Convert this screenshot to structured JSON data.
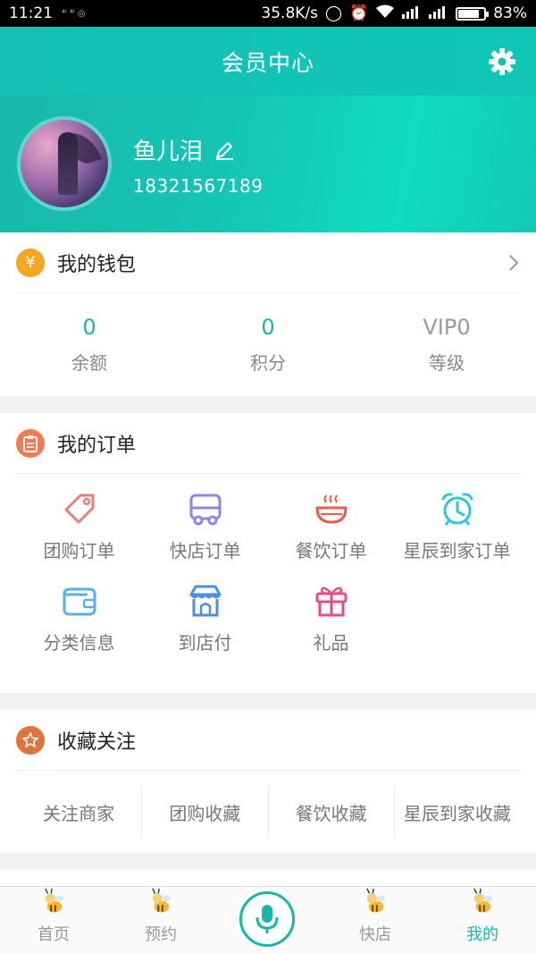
{
  "status_bar": {
    "time": "11:21",
    "speed": "35.8K/s",
    "battery": "83%",
    "battery_level": 0.83
  },
  "header": {
    "title": "会员中心"
  },
  "profile": {
    "name": "鱼儿泪",
    "phone": "18321567189"
  },
  "wallet": {
    "title": "我的钱包",
    "icon_symbol": "¥",
    "stats": [
      {
        "value": "0",
        "label": "余额"
      },
      {
        "value": "0",
        "label": "积分"
      },
      {
        "value": "VIP0",
        "label": "等级"
      }
    ]
  },
  "orders": {
    "title": "我的订单",
    "items": [
      {
        "label": "团购订单",
        "icon": "tag-icon",
        "color": "#f07b7b"
      },
      {
        "label": "快店订单",
        "icon": "truck-icon",
        "color": "#8b86e8"
      },
      {
        "label": "餐饮订单",
        "icon": "bowl-icon",
        "color": "#f05a4a"
      },
      {
        "label": "星辰到家订单",
        "icon": "alarm-clock-icon",
        "color": "#2cc7e0"
      },
      {
        "label": "分类信息",
        "icon": "wallet-icon",
        "color": "#5aaeea"
      },
      {
        "label": "到店付",
        "icon": "store-icon",
        "color": "#4d8ee0"
      },
      {
        "label": "礼品",
        "icon": "gift-icon",
        "color": "#e44c8a"
      }
    ]
  },
  "favorites": {
    "title": "收藏关注",
    "items": [
      "关注商家",
      "团购收藏",
      "餐饮收藏",
      "星辰到家收藏"
    ]
  },
  "tabbar": {
    "items": [
      {
        "label": "首页",
        "active": false
      },
      {
        "label": "预约",
        "active": false
      },
      {
        "label": "",
        "active": false
      },
      {
        "label": "快店",
        "active": false
      },
      {
        "label": "我的",
        "active": true
      }
    ]
  },
  "colors": {
    "accent": "#14b8aa",
    "wallet_icon": "#f5a623",
    "orders_icon": "#f27a55",
    "favorites_icon": "#e0743a"
  }
}
